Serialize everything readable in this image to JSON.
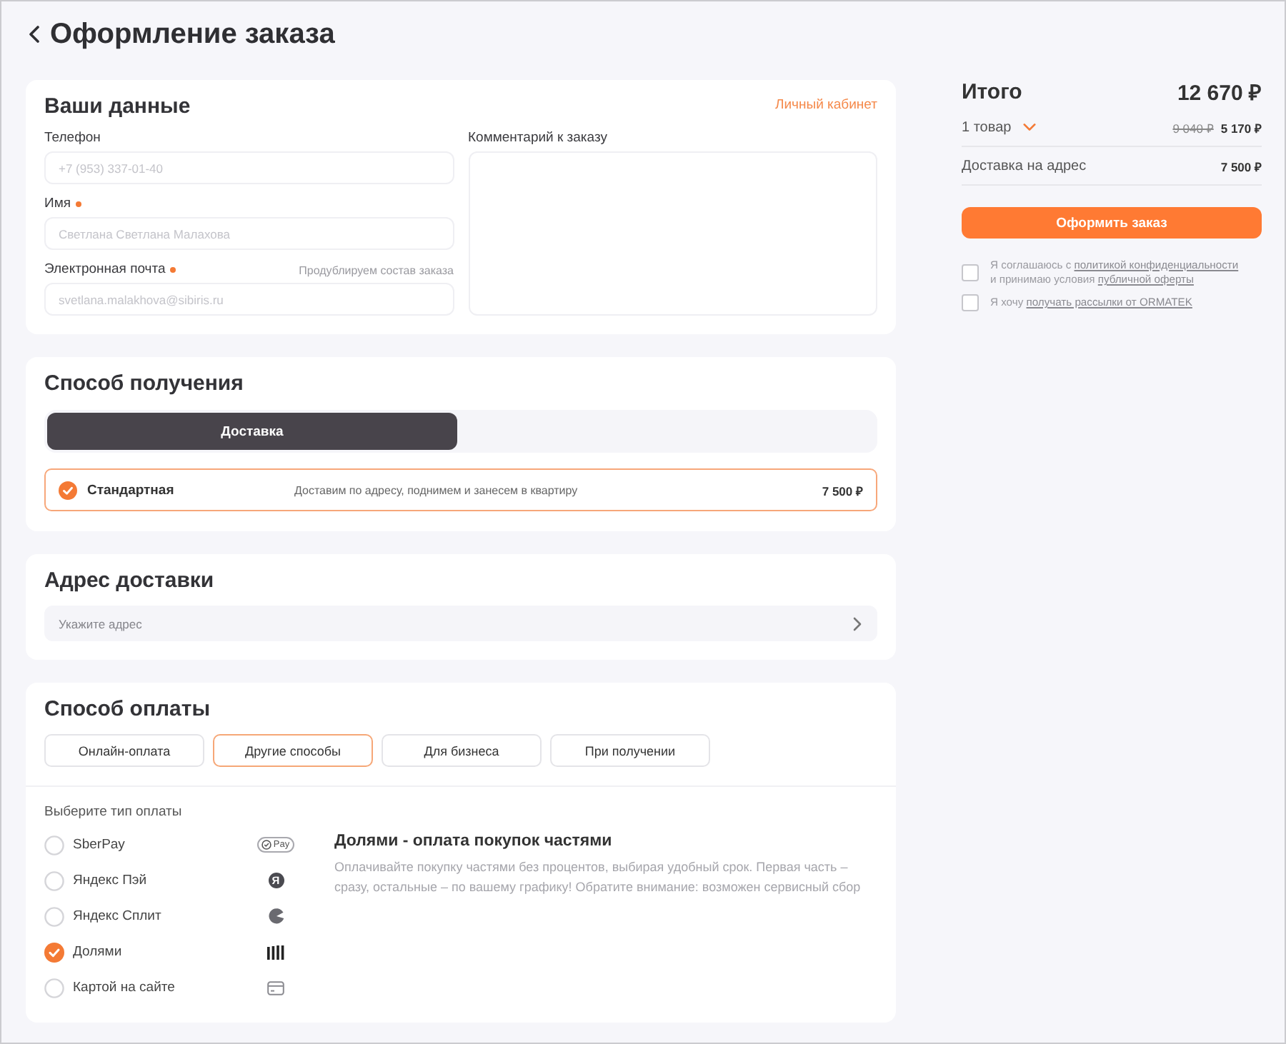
{
  "header": {
    "title": "Оформление заказа"
  },
  "contact": {
    "title": "Ваши данные",
    "account_link": "Личный кабинет",
    "fields": [
      {
        "label": "Телефон",
        "required": false,
        "value": "+7 (953) 337-01-40"
      },
      {
        "label": "Имя",
        "required": true,
        "value": "Светлана Светлана Малахова"
      },
      {
        "label": "Электронная почта",
        "required": true,
        "hint": "Продублируем состав заказа",
        "value": "svetlana.malakhova@sibiris.ru"
      }
    ],
    "comment": {
      "label": "Комментарий к заказу"
    }
  },
  "receipt": {
    "title": "Способ получения",
    "modes": [
      {
        "label": "Доставка",
        "selected": true
      }
    ],
    "options": [
      {
        "name": "Стандартная",
        "description": "Доставим по адресу, поднимем и занесем в квартиру",
        "price": "7 500 ₽",
        "selected": true
      }
    ]
  },
  "address": {
    "title": "Адрес доставки",
    "placeholder": "Укажите адрес"
  },
  "payment": {
    "title": "Способ оплаты",
    "tabs": [
      {
        "label": "Онлайн-оплата",
        "selected": false
      },
      {
        "label": "Другие способы",
        "selected": true
      },
      {
        "label": "Для бизнеса",
        "selected": false
      },
      {
        "label": "При получении",
        "selected": false
      }
    ],
    "list_label": "Выберите тип оплаты",
    "methods": [
      {
        "name": "SberPay",
        "kind": "sberpay",
        "logo_text": "Pay",
        "selected": false
      },
      {
        "name": "Яндекс Пэй",
        "kind": "yandexpay",
        "logo_text": "Я",
        "selected": false
      },
      {
        "name": "Яндекс Сплит",
        "kind": "split",
        "selected": false
      },
      {
        "name": "Долями",
        "kind": "dolyami",
        "selected": true
      },
      {
        "name": "Картой на сайте",
        "kind": "card",
        "selected": false
      }
    ],
    "detail": {
      "title": "Долями - оплата покупок частями",
      "text": "Оплачивайте покупку частями без процентов, выбирая удобный срок. Первая часть – сразу, остальные – по вашему графику! Обратите внимание: возможен сервисный сбор"
    }
  },
  "summary": {
    "total_label": "Итого",
    "total": "12 670 ₽",
    "items_label": "1 товар",
    "old_price": "9 040 ₽",
    "price": "5 170 ₽",
    "delivery_label": "Доставка на адрес",
    "delivery_price": "7 500 ₽",
    "submit": "Оформить заказ",
    "agreements": [
      {
        "checked": false,
        "parts": [
          {
            "kind": "text",
            "text": "Я соглашаюсь с"
          },
          {
            "kind": "link",
            "text": "политикой конфиденциальности"
          },
          {
            "kind": "text",
            "text": "и принимаю условия"
          },
          {
            "kind": "link",
            "text": "публичной оферты"
          }
        ]
      },
      {
        "checked": false,
        "parts": [
          {
            "kind": "text",
            "text": "Я хочу"
          },
          {
            "kind": "link",
            "text": "получать рассылки от ORMATEK"
          }
        ]
      }
    ]
  }
}
